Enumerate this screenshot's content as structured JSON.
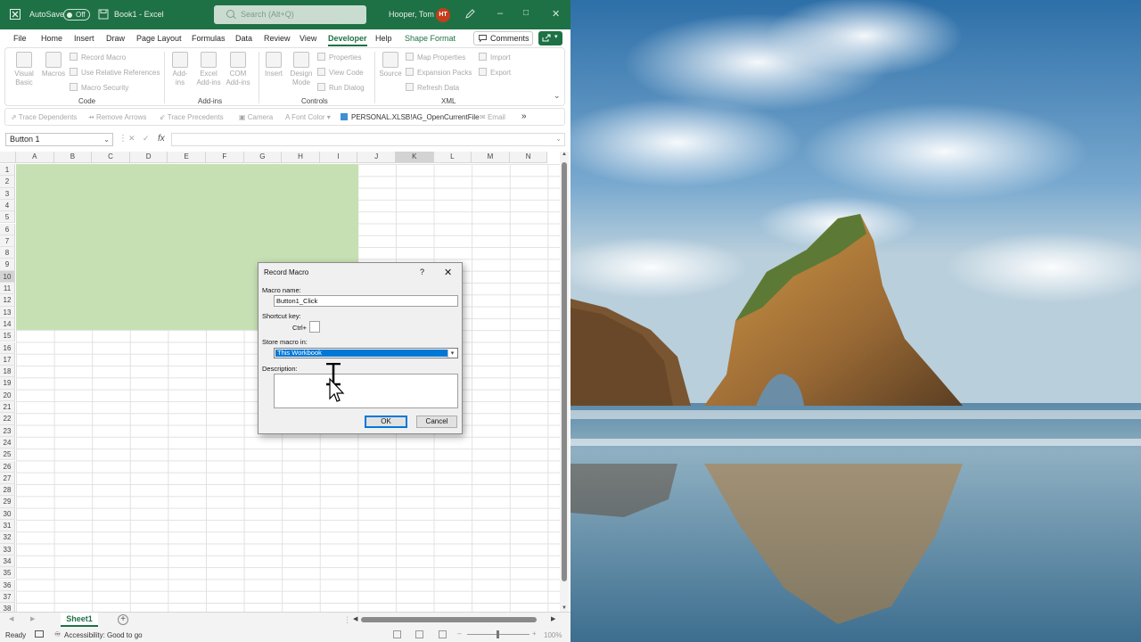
{
  "titlebar": {
    "autosave_label": "AutoSave",
    "autosave_state": "Off",
    "filename": "Book1",
    "separator": "-",
    "app_name": "Excel",
    "search_placeholder": "Search (Alt+Q)",
    "user_name": "Hooper, Tom",
    "user_initials": "HT",
    "colors": {
      "bar": "#1e7145",
      "avatar": "#c43e1c"
    }
  },
  "menu": {
    "tabs": [
      "File",
      "Home",
      "Insert",
      "Draw",
      "Page Layout",
      "Formulas",
      "Data",
      "Review",
      "View",
      "Developer",
      "Help",
      "Shape Format"
    ],
    "active_tab": "Developer",
    "comments_label": "Comments"
  },
  "ribbon": {
    "code": {
      "visual_basic": "Visual Basic",
      "macros": "Macros",
      "record_macro": "Record Macro",
      "relative_refs": "Use Relative References",
      "macro_security": "Macro Security",
      "label": "Code"
    },
    "addins": {
      "addins": "Add-ins",
      "excel_addins": "Excel Add-ins",
      "com_addins": "COM Add-ins",
      "label": "Add-ins"
    },
    "controls": {
      "insert": "Insert",
      "design_mode": "Design Mode",
      "properties": "Properties",
      "view_code": "View Code",
      "run_dialog": "Run Dialog",
      "label": "Controls"
    },
    "xml": {
      "source": "Source",
      "map_properties": "Map Properties",
      "expansion_packs": "Expansion Packs",
      "refresh_data": "Refresh Data",
      "import": "Import",
      "export": "Export",
      "label": "XML"
    }
  },
  "quick_access": {
    "trace_dependents": "Trace Dependents",
    "remove_arrows": "Remove Arrows",
    "trace_precedents": "Trace Precedents",
    "camera": "Camera",
    "font_color": "Font Color",
    "macro": "PERSONAL.XLSB!AG_OpenCurrentFile",
    "email": "Email",
    "more": "»"
  },
  "formula_bar": {
    "name_box": "Button 1",
    "fx": "fx",
    "cancel": "✕",
    "enter": "✓"
  },
  "grid": {
    "columns": [
      "A",
      "B",
      "C",
      "D",
      "E",
      "F",
      "G",
      "H",
      "I",
      "J",
      "K",
      "L",
      "M",
      "N"
    ],
    "selected_column": "K",
    "rows": [
      "1",
      "2",
      "3",
      "4",
      "5",
      "6",
      "7",
      "8",
      "9",
      "10",
      "11",
      "12",
      "13",
      "14",
      "15",
      "16",
      "17",
      "18",
      "19",
      "20",
      "21",
      "22",
      "23",
      "24",
      "25",
      "26",
      "27",
      "28",
      "29",
      "30",
      "31",
      "32",
      "33",
      "34",
      "35",
      "36",
      "37",
      "38"
    ],
    "selected_row": "10",
    "shape_color": "#c6e0b4"
  },
  "sheets": {
    "tabs": [
      "Sheet1"
    ],
    "add": "+"
  },
  "status": {
    "ready": "Ready",
    "accessibility": "Accessibility: Good to go",
    "zoom": "100%"
  },
  "dialog": {
    "title": "Record Macro",
    "help": "?",
    "close": "✕",
    "macro_name_label": "Macro name:",
    "macro_name_value": "Button1_Click",
    "shortcut_label": "Shortcut key:",
    "ctrl_label": "Ctrl+",
    "shortcut_value": "",
    "store_label": "Store macro in:",
    "store_value": "This Workbook",
    "description_label": "Description:",
    "description_value": "",
    "ok": "OK",
    "cancel": "Cancel"
  }
}
